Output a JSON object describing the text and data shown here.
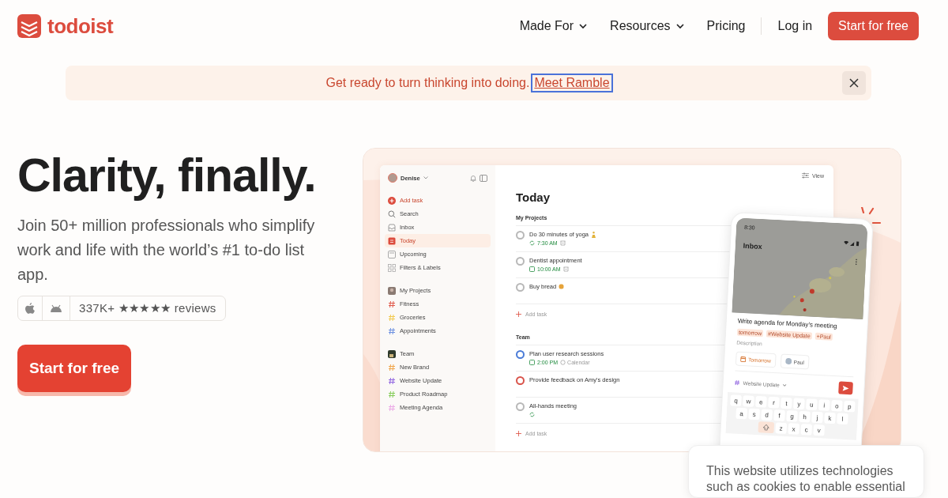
{
  "nav": {
    "logo": "todoist",
    "items": [
      {
        "label": "Made For",
        "dropdown": true
      },
      {
        "label": "Resources",
        "dropdown": true
      },
      {
        "label": "Pricing",
        "dropdown": false
      }
    ],
    "login": "Log in",
    "cta": "Start for free"
  },
  "banner": {
    "text": "Get ready to turn thinking into doing.",
    "link": "Meet Ramble",
    "focused": true
  },
  "hero": {
    "title": "Clarity, finally.",
    "subtitle": "Join 50+ million professionals who simplify work and life with the world’s #1 to-do list app.",
    "reviews": "337K+ ★★★★★ reviews",
    "cta": "Start for free"
  },
  "app_preview": {
    "user": "Denise",
    "view": "View",
    "nav": [
      {
        "label": "Add task",
        "kind": "add",
        "selected": false
      },
      {
        "label": "Search",
        "kind": "search",
        "selected": false
      },
      {
        "label": "Inbox",
        "kind": "inbox",
        "selected": false
      },
      {
        "label": "Today",
        "kind": "today",
        "selected": true
      },
      {
        "label": "Upcoming",
        "kind": "upcoming",
        "selected": false
      },
      {
        "label": "Filters & Labels",
        "kind": "filters",
        "selected": false
      }
    ],
    "groups": [
      {
        "title": "My Projects",
        "kind": "personal",
        "projects": [
          {
            "label": "Fitness",
            "color": "#e05a4b"
          },
          {
            "label": "Groceries",
            "color": "#f2c94c"
          },
          {
            "label": "Appointments",
            "color": "#6b8fe0"
          }
        ]
      },
      {
        "title": "Team",
        "kind": "team",
        "projects": [
          {
            "label": "New Brand",
            "color": "#f0a54a"
          },
          {
            "label": "Website Update",
            "color": "#8f63e0"
          },
          {
            "label": "Product Roadmap",
            "color": "#86cc5a"
          },
          {
            "label": "Meeting Agenda",
            "color": "#eba8e6"
          }
        ]
      }
    ],
    "heading": "Today",
    "sections": [
      {
        "title": "My Projects",
        "add": "Add task",
        "tasks": [
          {
            "name": "Do 30 minutes of yoga",
            "emoji": {
              "kind": "figure"
            },
            "due": {
              "kind": "recurring",
              "time": "7:30 AM"
            },
            "tray": true,
            "color": "#b8b8b8"
          },
          {
            "name": "Dentist appointment",
            "due": {
              "kind": "date",
              "time": "10:00 AM"
            },
            "tray": true,
            "color": "#b8b8b8"
          },
          {
            "name": "Buy bread",
            "emoji": {
              "kind": "bread"
            },
            "color": "#b8b8b8"
          }
        ]
      },
      {
        "title": "Team",
        "add": "Add task",
        "tasks": [
          {
            "name": "Plan user research sessions",
            "due": {
              "kind": "date",
              "time": "2:00 PM"
            },
            "calendar": "Calendar",
            "color": "#4a7bd8"
          },
          {
            "name": "Provide feedback on Amy's design",
            "color": "#d9534a"
          },
          {
            "name": "All-hands meeting",
            "due": {
              "kind": "recurring"
            },
            "color": "#b8b8b8"
          }
        ]
      }
    ]
  },
  "phone": {
    "clock": "8:30",
    "title": "Inbox",
    "task": "Write agenda for Monday’s meeting",
    "tags": [
      "tomorrow",
      "#Website Update",
      "+Paul"
    ],
    "description": "Description",
    "due": "Tomorrow",
    "assignee": "Paul",
    "project": "Website Update",
    "keyboard": [
      [
        "q",
        "w",
        "e",
        "r",
        "t",
        "y",
        "u",
        "i",
        "o",
        "p"
      ],
      [
        "a",
        "s",
        "d",
        "f",
        "g",
        "h",
        "j",
        "k",
        "l"
      ],
      [
        "z",
        "x",
        "c",
        "v"
      ]
    ]
  },
  "cookie": {
    "text": "This website utilizes technologies such as cookies to enable essential"
  }
}
